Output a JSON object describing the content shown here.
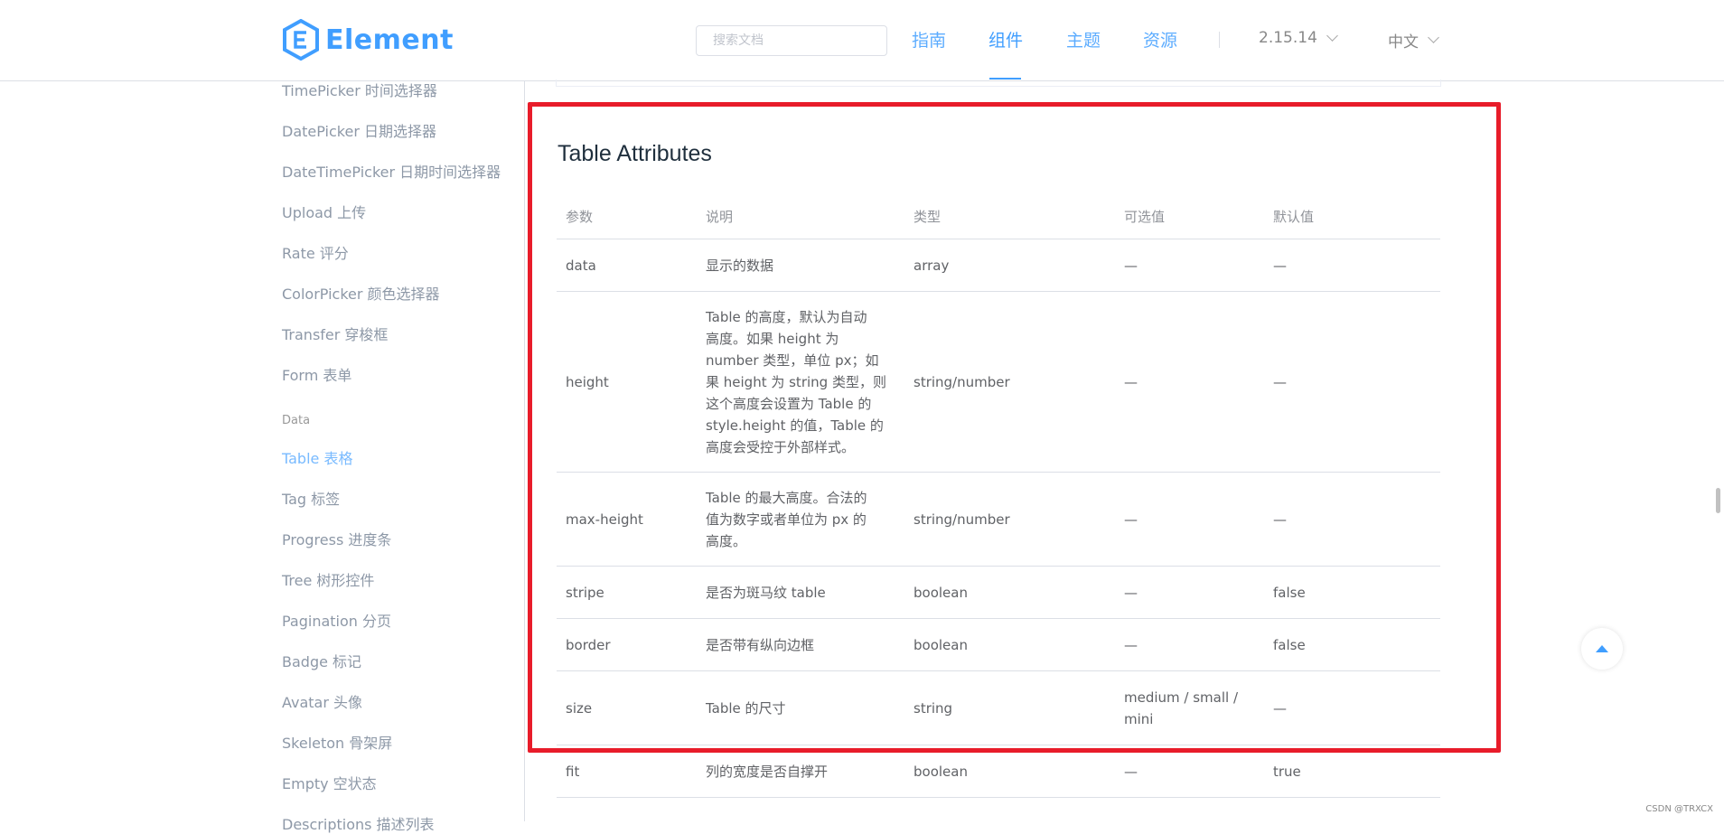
{
  "header": {
    "logo_text": "Element",
    "search_placeholder": "搜索文档",
    "nav": [
      "指南",
      "组件",
      "主题",
      "资源"
    ],
    "active_nav": "组件",
    "version": "2.15.14",
    "language": "中文",
    "accent_color": "#409eff"
  },
  "sidebar": {
    "items_before": [
      "TimePicker 时间选择器",
      "DatePicker 日期选择器",
      "DateTimePicker 日期时间选择器",
      "Upload 上传",
      "Rate 评分",
      "ColorPicker 颜色选择器",
      "Transfer 穿梭框",
      "Form 表单"
    ],
    "group_label": "Data",
    "items_after": [
      "Table 表格",
      "Tag 标签",
      "Progress 进度条",
      "Tree 树形控件",
      "Pagination 分页",
      "Badge 标记",
      "Avatar 头像",
      "Skeleton 骨架屏",
      "Empty 空状态",
      "Descriptions 描述列表"
    ],
    "active_item": "Table 表格"
  },
  "main": {
    "section_title": "Table Attributes",
    "columns": [
      "参数",
      "说明",
      "类型",
      "可选值",
      "默认值"
    ],
    "rows": [
      {
        "param": "data",
        "desc": [
          "显示的数据"
        ],
        "type": "array",
        "options": [
          "—"
        ],
        "default": "—"
      },
      {
        "param": "height",
        "desc": [
          "Table 的高度，默认为自动",
          "高度。如果 height 为",
          "number 类型，单位 px；如",
          "果 height 为 string 类型，则",
          "这个高度会设置为 Table 的",
          "style.height 的值，Table 的",
          "高度会受控于外部样式。"
        ],
        "type": "string/number",
        "options": [
          "—"
        ],
        "default": "—"
      },
      {
        "param": "max-height",
        "desc": [
          "Table 的最大高度。合法的",
          "值为数字或者单位为 px 的",
          "高度。"
        ],
        "type": "string/number",
        "options": [
          "—"
        ],
        "default": "—"
      },
      {
        "param": "stripe",
        "desc": [
          "是否为斑马纹 table"
        ],
        "type": "boolean",
        "options": [
          "—"
        ],
        "default": "false"
      },
      {
        "param": "border",
        "desc": [
          "是否带有纵向边框"
        ],
        "type": "boolean",
        "options": [
          "—"
        ],
        "default": "false"
      },
      {
        "param": "size",
        "desc": [
          "Table 的尺寸"
        ],
        "type": "string",
        "options": [
          "medium / small /",
          "mini"
        ],
        "default": "—"
      },
      {
        "param": "fit",
        "desc": [
          "列的宽度是否自撑开"
        ],
        "type": "boolean",
        "options": [
          "—"
        ],
        "default": "true"
      }
    ]
  },
  "highlight_color": "#e81c2a",
  "back_to_top_icon": "caret-up-icon",
  "watermark": "CSDN @TRXCX"
}
